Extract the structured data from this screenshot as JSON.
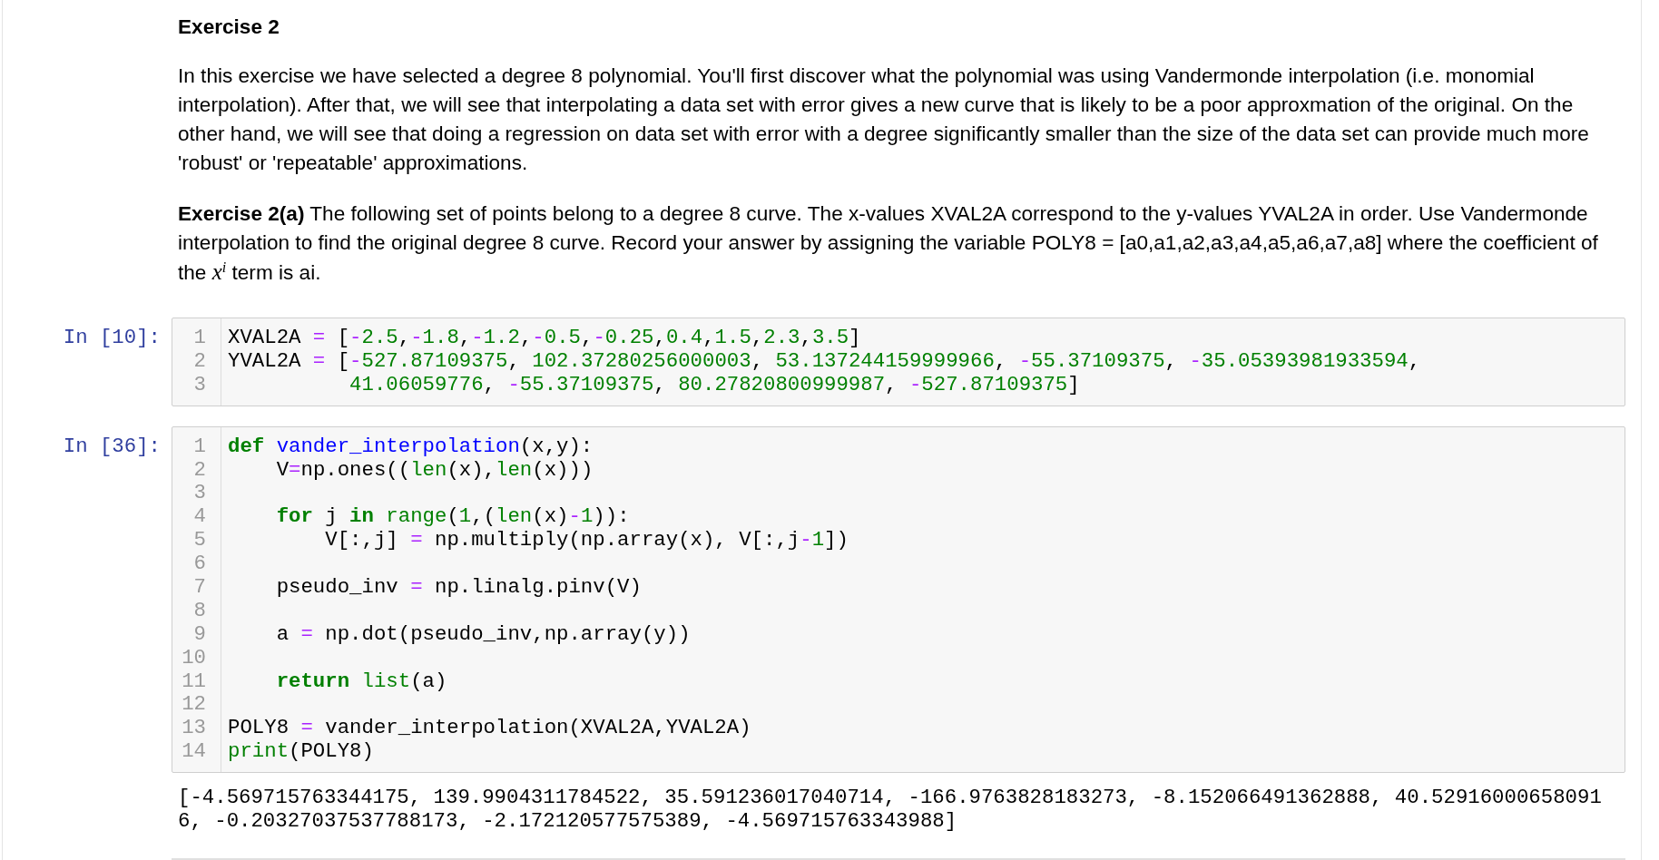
{
  "markdown": {
    "heading": "Exercise 2",
    "paragraphs": [
      "In this exercise we have selected a degree 8 polynomial. You'll first discover what the polynomial was using Vandermonde interpolation (i.e. monomial interpolation). After that, we will see that interpolating a data set with error gives a new curve that is likely to be a poor approxmation of the original. On the other hand, we will see that doing a regression on data set with error with a degree significantly smaller than the size of the data set can provide much more 'robust' or 'repeatable' approximations.",
      "**Exercise 2(a)** The following set of points belong to a degree 8 curve. The x-values XVAL2A correspond to the y-values YVAL2A in order. Use Vandermonde interpolation to find the original degree 8 curve. Record your answer by assigning the variable POLY8 = [a0,a1,a2,a3,a4,a5,a6,a7,a8] where the coefficient of the *x*$^{i}$ term is ai."
    ]
  },
  "cells": [
    {
      "prompt": "In [10]:",
      "lines": [
        {
          "number": "1",
          "tokens": [
            {
              "kind": "plain",
              "text": "XVAL2A "
            },
            {
              "kind": "operator",
              "text": "="
            },
            {
              "kind": "plain",
              "text": " ["
            },
            {
              "kind": "operator",
              "text": "-"
            },
            {
              "kind": "number",
              "text": "2.5"
            },
            {
              "kind": "plain",
              "text": ","
            },
            {
              "kind": "operator",
              "text": "-"
            },
            {
              "kind": "number",
              "text": "1.8"
            },
            {
              "kind": "plain",
              "text": ","
            },
            {
              "kind": "operator",
              "text": "-"
            },
            {
              "kind": "number",
              "text": "1.2"
            },
            {
              "kind": "plain",
              "text": ","
            },
            {
              "kind": "operator",
              "text": "-"
            },
            {
              "kind": "number",
              "text": "0.5"
            },
            {
              "kind": "plain",
              "text": ","
            },
            {
              "kind": "operator",
              "text": "-"
            },
            {
              "kind": "number",
              "text": "0.25"
            },
            {
              "kind": "plain",
              "text": ","
            },
            {
              "kind": "number",
              "text": "0.4"
            },
            {
              "kind": "plain",
              "text": ","
            },
            {
              "kind": "number",
              "text": "1.5"
            },
            {
              "kind": "plain",
              "text": ","
            },
            {
              "kind": "number",
              "text": "2.3"
            },
            {
              "kind": "plain",
              "text": ","
            },
            {
              "kind": "number",
              "text": "3.5"
            },
            {
              "kind": "plain",
              "text": "]"
            }
          ]
        },
        {
          "number": "2",
          "tokens": [
            {
              "kind": "plain",
              "text": "YVAL2A "
            },
            {
              "kind": "operator",
              "text": "="
            },
            {
              "kind": "plain",
              "text": " ["
            },
            {
              "kind": "operator",
              "text": "-"
            },
            {
              "kind": "number",
              "text": "527.87109375"
            },
            {
              "kind": "plain",
              "text": ", "
            },
            {
              "kind": "number",
              "text": "102.37280256000003"
            },
            {
              "kind": "plain",
              "text": ", "
            },
            {
              "kind": "number",
              "text": "53.137244159999966"
            },
            {
              "kind": "plain",
              "text": ", "
            },
            {
              "kind": "operator",
              "text": "-"
            },
            {
              "kind": "number",
              "text": "55.37109375"
            },
            {
              "kind": "plain",
              "text": ", "
            },
            {
              "kind": "operator",
              "text": "-"
            },
            {
              "kind": "number",
              "text": "35.05393981933594"
            },
            {
              "kind": "plain",
              "text": ","
            }
          ]
        },
        {
          "number": "3",
          "tokens": [
            {
              "kind": "number",
              "text": "          41.06059776"
            },
            {
              "kind": "plain",
              "text": ", "
            },
            {
              "kind": "operator",
              "text": "-"
            },
            {
              "kind": "number",
              "text": "55.37109375"
            },
            {
              "kind": "plain",
              "text": ", "
            },
            {
              "kind": "number",
              "text": "80.27820800999987"
            },
            {
              "kind": "plain",
              "text": ", "
            },
            {
              "kind": "operator",
              "text": "-"
            },
            {
              "kind": "number",
              "text": "527.87109375"
            },
            {
              "kind": "plain",
              "text": "]"
            }
          ]
        }
      ]
    },
    {
      "prompt": "In [36]:",
      "lines": [
        {
          "number": "1",
          "tokens": [
            {
              "kind": "keyword",
              "text": "def "
            },
            {
              "kind": "function",
              "text": "vander_interpolation"
            },
            {
              "kind": "plain",
              "text": "(x,y):"
            }
          ]
        },
        {
          "number": "2",
          "tokens": [
            {
              "kind": "plain",
              "text": "    V"
            },
            {
              "kind": "operator",
              "text": "="
            },
            {
              "kind": "plain",
              "text": "np.ones(("
            },
            {
              "kind": "builtin",
              "text": "len"
            },
            {
              "kind": "plain",
              "text": "(x),"
            },
            {
              "kind": "builtin",
              "text": "len"
            },
            {
              "kind": "plain",
              "text": "(x)))"
            }
          ]
        },
        {
          "number": "3"
        },
        {
          "number": "4",
          "tokens": [
            {
              "kind": "keyword",
              "text": "    for"
            },
            {
              "kind": "plain",
              "text": " j "
            },
            {
              "kind": "keyword",
              "text": "in "
            },
            {
              "kind": "builtin",
              "text": "range"
            },
            {
              "kind": "plain",
              "text": "("
            },
            {
              "kind": "number",
              "text": "1"
            },
            {
              "kind": "plain",
              "text": ",("
            },
            {
              "kind": "builtin",
              "text": "len"
            },
            {
              "kind": "plain",
              "text": "(x)"
            },
            {
              "kind": "operator",
              "text": "-"
            },
            {
              "kind": "number",
              "text": "1"
            },
            {
              "kind": "plain",
              "text": ")):"
            }
          ]
        },
        {
          "number": "5",
          "tokens": [
            {
              "kind": "plain",
              "text": "        V[:,j] "
            },
            {
              "kind": "operator",
              "text": "="
            },
            {
              "kind": "plain",
              "text": " np.multiply(np.array(x), V[:,j"
            },
            {
              "kind": "operator",
              "text": "-"
            },
            {
              "kind": "number",
              "text": "1"
            },
            {
              "kind": "plain",
              "text": "])"
            }
          ]
        },
        {
          "number": "6"
        },
        {
          "number": "7",
          "tokens": [
            {
              "kind": "plain",
              "text": "    pseudo_inv "
            },
            {
              "kind": "operator",
              "text": "="
            },
            {
              "kind": "plain",
              "text": " np.linalg.pinv(V)"
            }
          ]
        },
        {
          "number": "8"
        },
        {
          "number": "9",
          "tokens": [
            {
              "kind": "plain",
              "text": "    a "
            },
            {
              "kind": "operator",
              "text": "="
            },
            {
              "kind": "plain",
              "text": " np.dot(pseudo_inv,np.array(y))"
            }
          ]
        },
        {
          "number": "10"
        },
        {
          "number": "11",
          "tokens": [
            {
              "kind": "keyword",
              "text": "    return "
            },
            {
              "kind": "builtin",
              "text": "list"
            },
            {
              "kind": "plain",
              "text": "(a)"
            }
          ]
        },
        {
          "number": "12"
        },
        {
          "number": "13",
          "tokens": [
            {
              "kind": "plain",
              "text": "POLY8 "
            },
            {
              "kind": "operator",
              "text": "="
            },
            {
              "kind": "plain",
              "text": " vander_interpolation(XVAL2A,YVAL2A)"
            }
          ]
        },
        {
          "number": "14",
          "tokens": [
            {
              "kind": "builtin",
              "text": "print"
            },
            {
              "kind": "plain",
              "text": "(POLY8)"
            }
          ]
        }
      ],
      "output": "[-4.569715763344175, 139.9904311784522, 35.591236017040714, -166.9763828183273, -8.152066491362888, 40.529160006580916, -0.20327037537788173, -2.172120577575389, -4.569715763343988]"
    }
  ]
}
